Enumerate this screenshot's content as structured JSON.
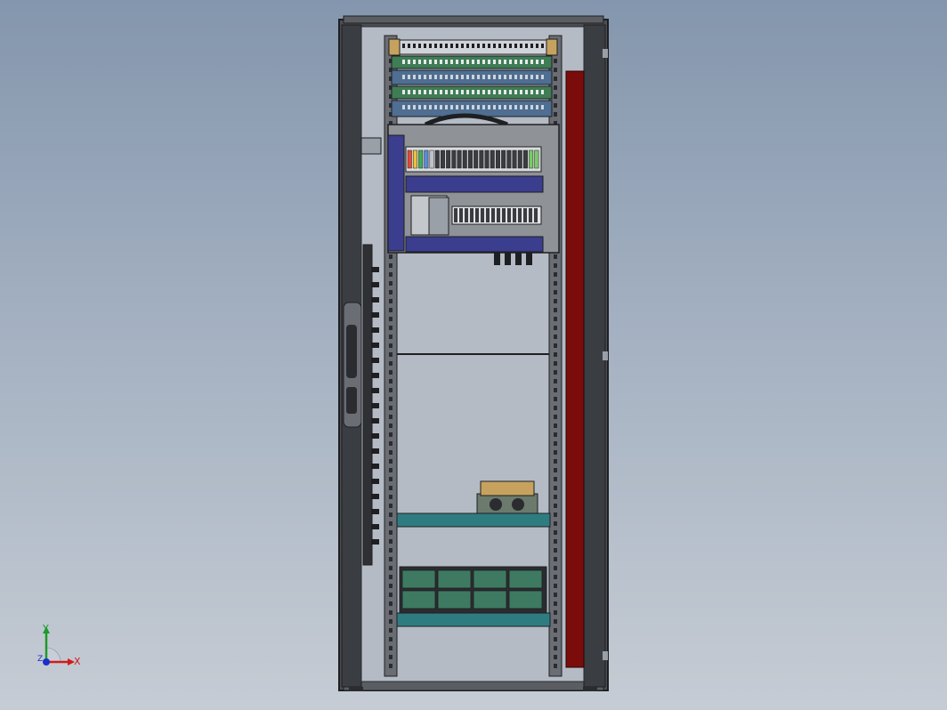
{
  "viewport": {
    "background_top": "#8496ad",
    "background_bottom": "#c6ccd4"
  },
  "colors": {
    "frame": "#3a3d42",
    "frame_edge": "#1e1f22",
    "inner_panel": "#b4bbc4",
    "patch_panel_blue": "#4e6e92",
    "terminal_green": "#3f7d55",
    "din_plate": "#8f9296",
    "cable_duct": "#3b3d8e",
    "side_panel_red": "#7a0c0c",
    "shelf_teal": "#2f7c80",
    "battery_green": "#3e7a62",
    "rail_gray": "#6a6e74",
    "module_tan": "#c6a25e"
  },
  "icons": {
    "triad": "coordinate-triad-icon"
  },
  "triad": {
    "x_label": "X",
    "y_label": "Y",
    "z_label": "Z"
  }
}
